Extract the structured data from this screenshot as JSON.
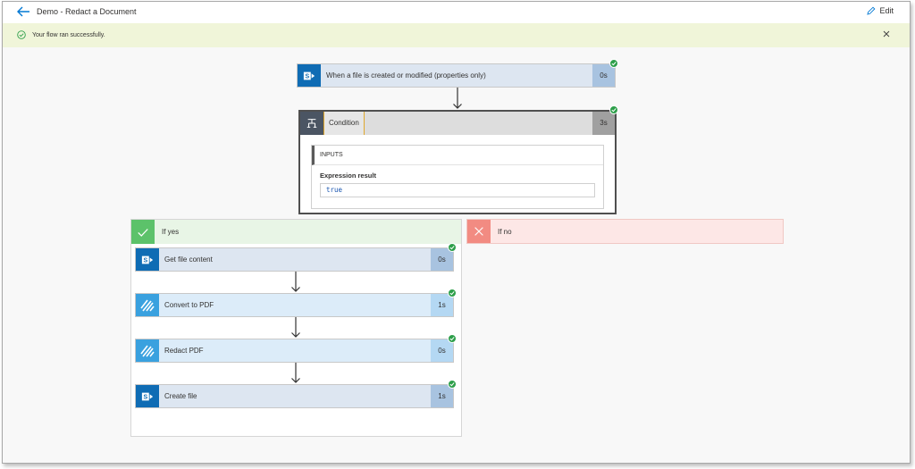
{
  "header": {
    "title": "Demo - Redact a Document",
    "edit_label": "Edit"
  },
  "banner": {
    "message": "Your flow ran successfully."
  },
  "trigger": {
    "label": "When a file is created or modified (properties only)",
    "duration": "0s",
    "icon": "sharepoint-icon"
  },
  "condition": {
    "label": "Condition",
    "duration": "3s",
    "inputs_heading": "INPUTS",
    "expression_label": "Expression result",
    "expression_value": "true"
  },
  "branches": {
    "yes_label": "If yes",
    "no_label": "If no"
  },
  "actions": [
    {
      "label": "Get file content",
      "duration": "0s",
      "icon": "sharepoint-icon"
    },
    {
      "label": "Convert to PDF",
      "duration": "1s",
      "icon": "pdf-services-icon"
    },
    {
      "label": "Redact PDF",
      "duration": "0s",
      "icon": "pdf-services-icon"
    },
    {
      "label": "Create file",
      "duration": "1s",
      "icon": "sharepoint-icon"
    }
  ],
  "colors": {
    "success": "#2d9f4a",
    "sharepoint": "#0f6cb4",
    "pdf_connector": "#3aa1df",
    "yes_branch": "#5cc26a",
    "no_branch": "#f28b82",
    "banner_bg": "#f0f5d9"
  }
}
